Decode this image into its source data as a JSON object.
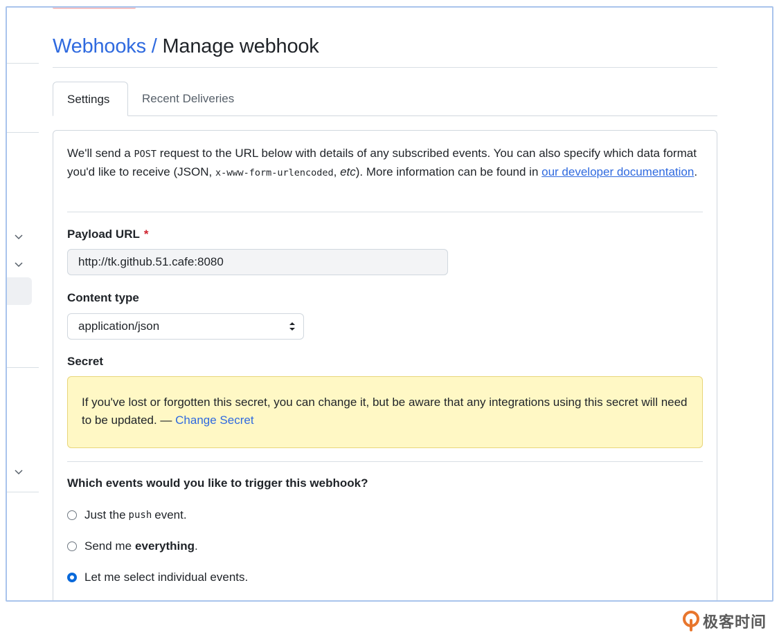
{
  "breadcrumb": {
    "parent": "Webhooks",
    "separator": "/",
    "current": "Manage webhook"
  },
  "tabs": [
    {
      "label": "Settings",
      "active": true
    },
    {
      "label": "Recent Deliveries",
      "active": false
    }
  ],
  "intro": {
    "text_1": "We'll send a ",
    "code_post": "POST",
    "text_2": " request to the URL below with details of any subscribed events. You can also specify which data format you'd like to receive (JSON, ",
    "code_format": "x-www-form-urlencoded",
    "text_3": ", ",
    "etc": "etc",
    "text_4": "). More information can be found in ",
    "link": "our developer documentation",
    "text_5": "."
  },
  "payload_url": {
    "label": "Payload URL",
    "required_marker": "*",
    "value": "http://tk.github.51.cafe:8080"
  },
  "content_type": {
    "label": "Content type",
    "selected": "application/json"
  },
  "secret": {
    "label": "Secret",
    "message": "If you've lost or forgotten this secret, you can change it, but be aware that any integrations using this secret will need to be updated. — ",
    "link": "Change Secret"
  },
  "events": {
    "question": "Which events would you like to trigger this webhook?",
    "options": [
      {
        "pre": "Just the",
        "code": "push",
        "post": "event.",
        "checked": false
      },
      {
        "pre": "Send me",
        "bold": "everything",
        "post": ".",
        "checked": false
      },
      {
        "pre": "Let me select individual events.",
        "checked": true
      }
    ]
  },
  "watermark": {
    "text": "极客时间"
  },
  "colors": {
    "link": "#2f6adf",
    "required": "#cf222e",
    "flash_bg": "#fff8c5",
    "radio_checked": "#0969da"
  }
}
